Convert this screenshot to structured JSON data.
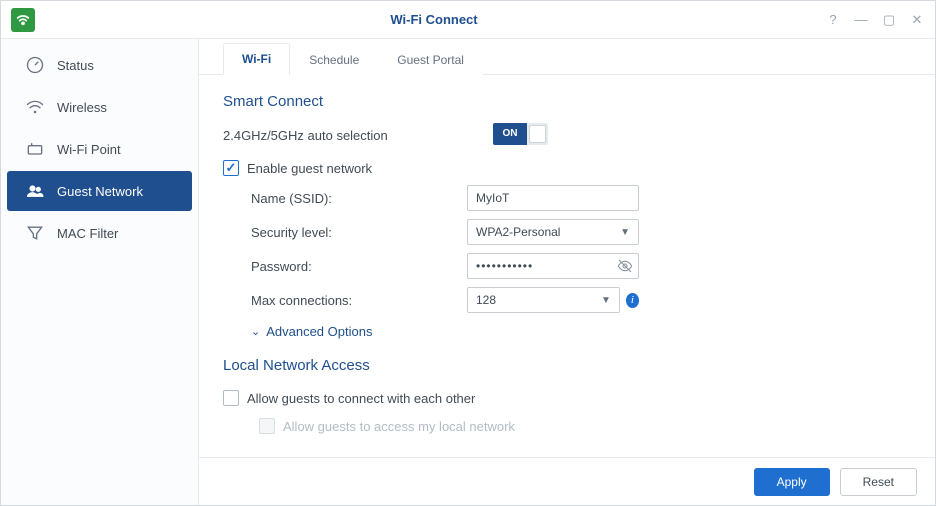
{
  "window": {
    "title": "Wi-Fi Connect"
  },
  "sidebar": {
    "items": [
      {
        "label": "Status"
      },
      {
        "label": "Wireless"
      },
      {
        "label": "Wi-Fi Point"
      },
      {
        "label": "Guest Network",
        "active": true
      },
      {
        "label": "MAC Filter"
      }
    ]
  },
  "tabs": [
    {
      "label": "Wi-Fi",
      "active": true
    },
    {
      "label": "Schedule"
    },
    {
      "label": "Guest Portal"
    }
  ],
  "sections": {
    "smart_connect": {
      "title": "Smart Connect",
      "auto_selection_label": "2.4GHz/5GHz auto selection",
      "toggle_text": "ON",
      "enable_guest_label": "Enable guest network",
      "enable_guest_checked": true,
      "fields": {
        "ssid_label": "Name (SSID):",
        "ssid_value": "MyIoT",
        "security_label": "Security level:",
        "security_value": "WPA2-Personal",
        "password_label": "Password:",
        "password_value": "•••••••••••",
        "max_conn_label": "Max connections:",
        "max_conn_value": "128"
      },
      "advanced_label": "Advanced Options"
    },
    "local_access": {
      "title": "Local Network Access",
      "allow_guests_each_other": "Allow guests to connect with each other",
      "allow_guests_each_other_checked": false,
      "allow_guests_local": "Allow guests to access my local network",
      "allow_guests_local_checked": false,
      "allow_guests_local_disabled": true
    }
  },
  "footer": {
    "apply": "Apply",
    "reset": "Reset"
  }
}
